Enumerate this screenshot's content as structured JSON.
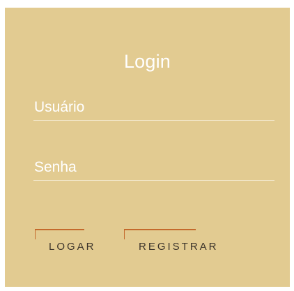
{
  "login": {
    "title": "Login",
    "username": {
      "placeholder": "Usuário",
      "value": ""
    },
    "password": {
      "placeholder": "Senha",
      "value": ""
    },
    "buttons": {
      "login_label": "LOGAR",
      "register_label": "REGISTRAR"
    }
  },
  "colors": {
    "card_background": "#e2cb91",
    "title_text": "#ffffff",
    "input_underline": "#f3e8cd",
    "button_text": "#3b332a",
    "button_accent": "#c46a2c"
  }
}
